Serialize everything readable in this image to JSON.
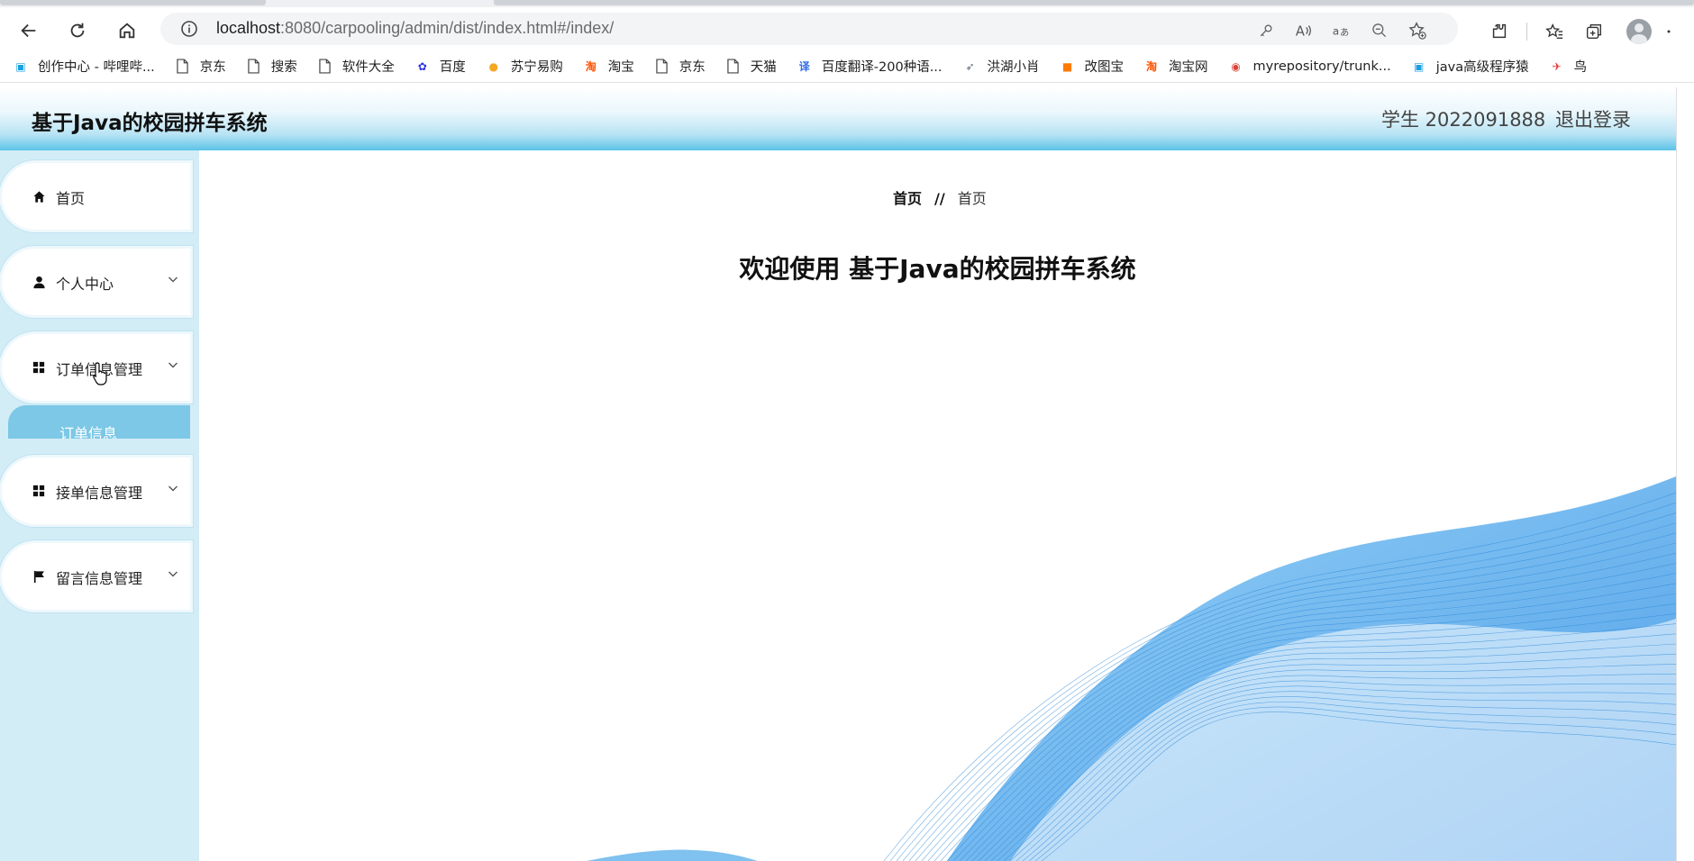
{
  "browser": {
    "url_host": "localhost",
    "url_rest": ":8080/carpooling/admin/dist/index.html#/index/",
    "bookmarks": [
      {
        "label": "创作中心 - 哔哩哔...",
        "icon": "bilibili-icon",
        "color": "#1aa0e0"
      },
      {
        "label": "京东",
        "icon": "page-icon",
        "color": "#444444"
      },
      {
        "label": "搜索",
        "icon": "page-icon",
        "color": "#444444"
      },
      {
        "label": "软件大全",
        "icon": "page-icon",
        "color": "#444444"
      },
      {
        "label": "百度",
        "icon": "baidu-paw-icon",
        "color": "#2932e1"
      },
      {
        "label": "苏宁易购",
        "icon": "suning-lion-icon",
        "color": "#f5a623"
      },
      {
        "label": "淘宝",
        "icon": "taobao-icon",
        "color": "#ff5000"
      },
      {
        "label": "京东",
        "icon": "page-icon",
        "color": "#444444"
      },
      {
        "label": "天猫",
        "icon": "page-icon",
        "color": "#444444"
      },
      {
        "label": "百度翻译-200种语...",
        "icon": "translate-icon",
        "color": "#2d6ce8"
      },
      {
        "label": "洪湖小肖",
        "icon": "bird-icon",
        "color": "#5a6b7a"
      },
      {
        "label": "改图宝",
        "icon": "gaitubao-icon",
        "color": "#ff7a00"
      },
      {
        "label": "淘宝网",
        "icon": "taobao-icon",
        "color": "#ff5000"
      },
      {
        "label": "myrepository/trunk...",
        "icon": "chrome-icon",
        "color": "#db4437"
      },
      {
        "label": "java高级程序猿",
        "icon": "bilibili-icon",
        "color": "#1aa0e0"
      },
      {
        "label": "鸟",
        "icon": "kingfisher-icon",
        "color": "#e53935"
      }
    ]
  },
  "header": {
    "title": "基于Java的校园拼车系统",
    "user": "学生 2022091888",
    "logout": "退出登录"
  },
  "sidebar": {
    "items": [
      {
        "label": "首页",
        "icon": "home-icon"
      },
      {
        "label": "个人中心",
        "icon": "user-icon"
      },
      {
        "label": "订单信息管理",
        "icon": "grid-icon"
      },
      {
        "label": "接单信息管理",
        "icon": "grid-icon"
      },
      {
        "label": "留言信息管理",
        "icon": "flag-icon"
      }
    ],
    "submenu": {
      "label": "订单信息"
    }
  },
  "main": {
    "breadcrumb": {
      "first": "首页",
      "separator": "//",
      "second": "首页"
    },
    "welcome": "欢迎使用 基于Java的校园拼车系统"
  },
  "colors": {
    "header_gradient_end": "#5cc3e8",
    "sidebar_bg": "#d3edf7",
    "submenu_bg": "#7cc8e6",
    "wave_blue": "#63b5f0"
  }
}
